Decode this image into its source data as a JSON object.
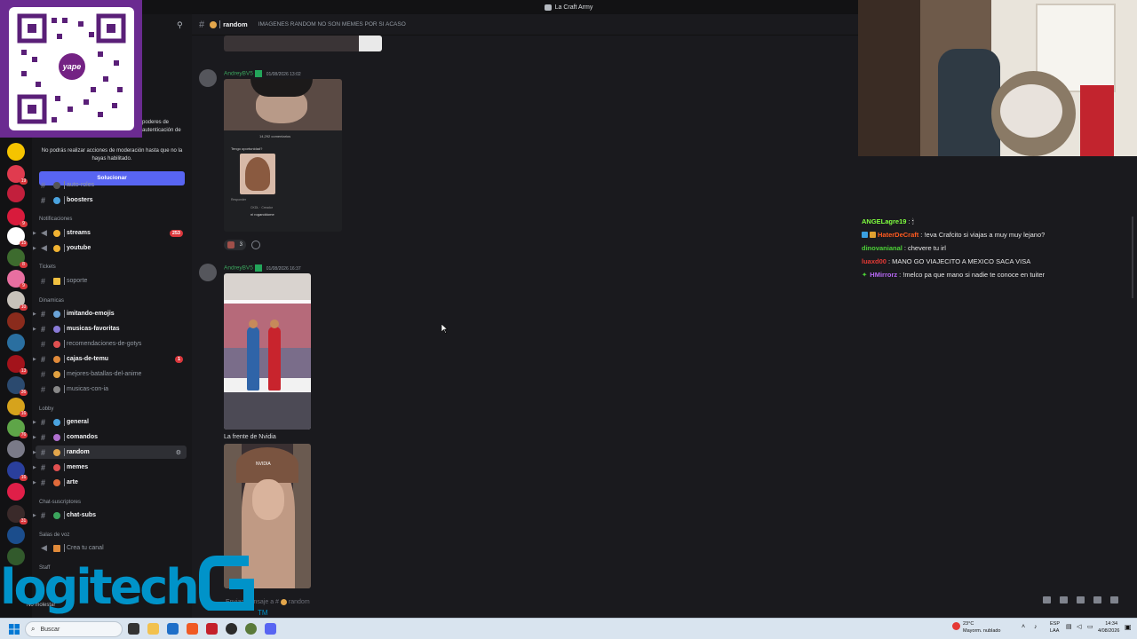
{
  "window": {
    "title": "La Craft Army"
  },
  "channel_header": {
    "name": "random",
    "topic": "IMAGENES RANDOM NO SON MEMES POR SI ACASO"
  },
  "notice": {
    "side_text": "poderes de autenticación de",
    "body": "No podrás realizar acciones de moderación hasta que no la hayas habilitado.",
    "button": "Solucionar"
  },
  "sidebar": {
    "categories": {
      "notificaciones": "Notificaciones",
      "tickets": "Tickets",
      "dinamicas": "Dinamicas",
      "lobby": "Lobby",
      "chat_suscriptores": "Chat-suscriptores",
      "salas_de_voz": "Salas de voz",
      "staff": "Staff"
    },
    "channels": {
      "auto_roles": "auto-roles",
      "boosters": "boosters",
      "streams": "streams",
      "streams_count": "253",
      "youtube": "youtube",
      "soporte": "soporte",
      "imitando_emojis": "imitando-emojis",
      "musicas_favoritas": "musicas-favoritas",
      "recomendaciones": "recomendaciones-de-gotys",
      "cajas_de_temu": "cajas-de-temu",
      "cajas_count": "1",
      "mejores_batallas": "mejores-batallas-del-anime",
      "musicas_con_ia": "musicas-con-ia",
      "general": "general",
      "comandos": "comandos",
      "random": "random",
      "memes": "memes",
      "arte": "arte",
      "chat_subs": "chat-subs",
      "crea_tu_canal": "Crea tu canal"
    },
    "user_status": "No molestar"
  },
  "messages": [
    {
      "author": "AndreyBV5",
      "timestamp": "01/08/2026 13:02",
      "reaction_count": "3"
    },
    {
      "author": "AndreyBV5",
      "timestamp": "01/08/2026 16:37",
      "caption": "La frente de Nvidia"
    }
  ],
  "embedded_screenshot": {
    "comments": "14,292 comentarios",
    "question": "Tengo oportunidad?",
    "reply_user": "CKDL · Creador",
    "reply_text": "ni roganddome",
    "reply_label": "Responder"
  },
  "image_texts": {
    "nvidia_watermark": "NVIDIA"
  },
  "composer": {
    "placeholder": "Enviar mensaje a #",
    "channel": "random"
  },
  "chat": [
    {
      "user": "ANGELagre19",
      "text": ": 🕯",
      "color": "#7fff3f"
    },
    {
      "user": "HaterDeCraft",
      "text": ": !eva Crafcito si viajas a muy muy lejano?",
      "color": "#ff5a1f"
    },
    {
      "user": "dinovanianal",
      "text": ": chevere tu irl",
      "color": "#4cd137"
    },
    {
      "user": "luaxd00",
      "text": ": MANO GO VIAJECITO A MEXICO SACA VISA",
      "color": "#e53935"
    },
    {
      "user": "HMirrorz",
      "text": ": !melco pa que mano si nadie te conoce en tuiter",
      "color": "#b768f5"
    }
  ],
  "overlay": {
    "brand": "logitech",
    "tm": "TM",
    "qr_brand": "yape"
  },
  "taskbar": {
    "search_placeholder": "Buscar",
    "weather_temp": "23°C",
    "weather_desc": "Mayorm. nublado",
    "lang": "ESP",
    "lang_sub": "LAA",
    "time": "14:34",
    "date": "4/08/2026"
  },
  "colors": {
    "accent": "#5865f2",
    "mention_green": "#3ba55d",
    "badge_red": "#da373c"
  }
}
